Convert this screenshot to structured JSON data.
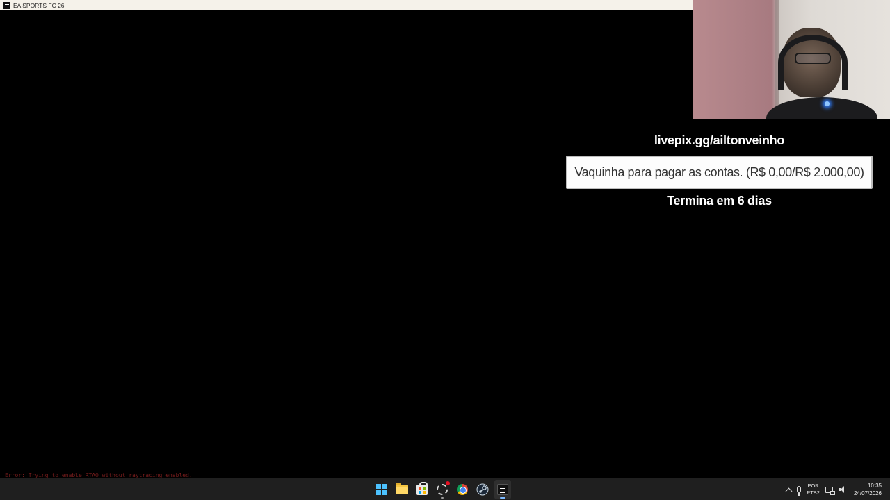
{
  "window": {
    "title": "EA SPORTS FC 26",
    "icon": "ea-sports-fc-icon"
  },
  "overlay": {
    "url": "livepix.gg/ailtonveinho",
    "goal_text": "Vaquinha para pagar as contas. (R$ 0,00/R$ 2.000,00)",
    "goal_current": 0,
    "goal_target": 2000,
    "ends_text": "Termina em 6 dias"
  },
  "console": {
    "error": "Error: Trying to enable RTAO without raytracing enabled."
  },
  "taskbar": {
    "pinned": [
      {
        "name": "start",
        "icon": "windows-start-icon"
      },
      {
        "name": "file-explorer",
        "icon": "folder-icon"
      },
      {
        "name": "microsoft-store",
        "icon": "store-icon"
      },
      {
        "name": "snipping-tool",
        "icon": "snip-icon"
      },
      {
        "name": "chrome",
        "icon": "chrome-icon"
      },
      {
        "name": "steam",
        "icon": "steam-icon"
      },
      {
        "name": "ea-app",
        "icon": "ea-icon",
        "active": true
      }
    ],
    "tray": {
      "lang_line1": "POR",
      "lang_line2": "PTB2",
      "time": "10:35",
      "date": "24/07/2026"
    }
  },
  "colors": {
    "overlay_text": "#ffffff",
    "goal_box_bg": "#fdfdfd",
    "goal_text": "#333333",
    "error_text": "#7a1d1d",
    "taskbar_bg": "#1f1f1f",
    "accent": "#4cc2ff"
  }
}
